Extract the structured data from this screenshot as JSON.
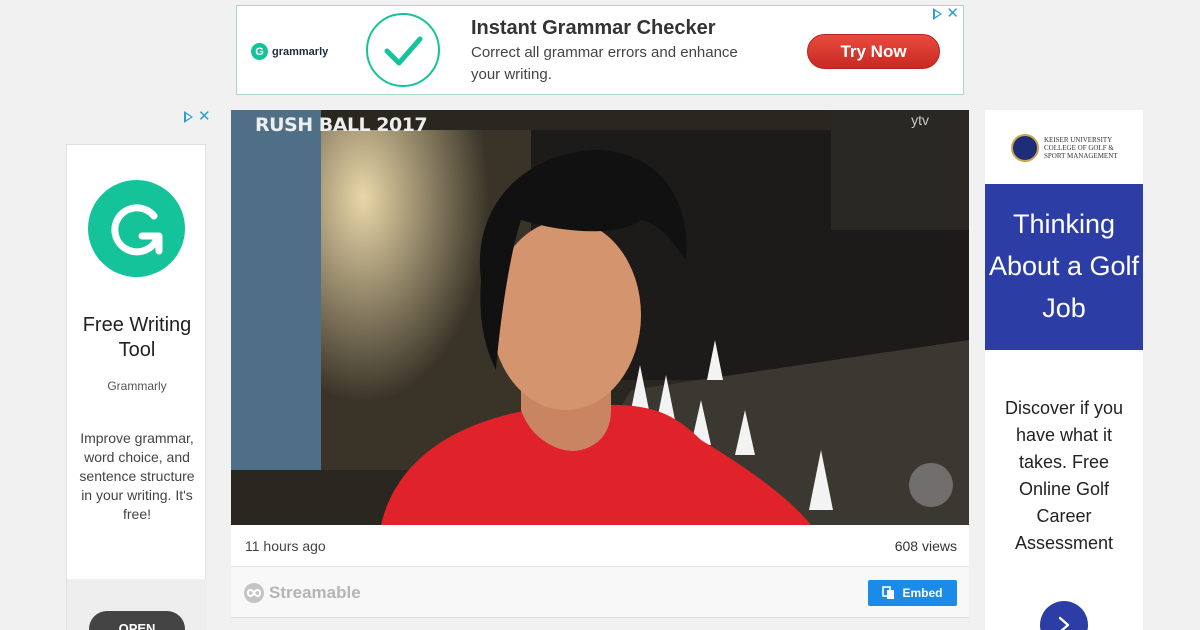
{
  "top_ad": {
    "brand": "grammarly",
    "brand_letter": "G",
    "headline": "Instant Grammar Checker",
    "body": "Correct all grammar errors and enhance your writing.",
    "cta": "Try Now",
    "accent_color": "#15c39a",
    "cta_color": "#d9352c"
  },
  "left_ad": {
    "title": "Free Writing Tool",
    "brand": "Grammarly",
    "description": "Improve grammar, word choice, and sentence structure in your writing. It's free!",
    "cta": "OPEN"
  },
  "video": {
    "caption": "RUSH BALL 2017",
    "watermark": "ytv",
    "time_ago": "11 hours ago",
    "views": "608 views",
    "platform": "Streamable",
    "embed_label": "Embed"
  },
  "right_ad": {
    "sponsor_line1": "KEISER UNIVERSITY",
    "sponsor_line2": "COLLEGE OF GOLF &",
    "sponsor_line3": "SPORT MANAGEMENT",
    "headline": "Thinking About a Golf Job",
    "description": "Discover if you have what it takes. Free Online Golf Career Assessment",
    "panel_color": "#2c3ea5"
  }
}
